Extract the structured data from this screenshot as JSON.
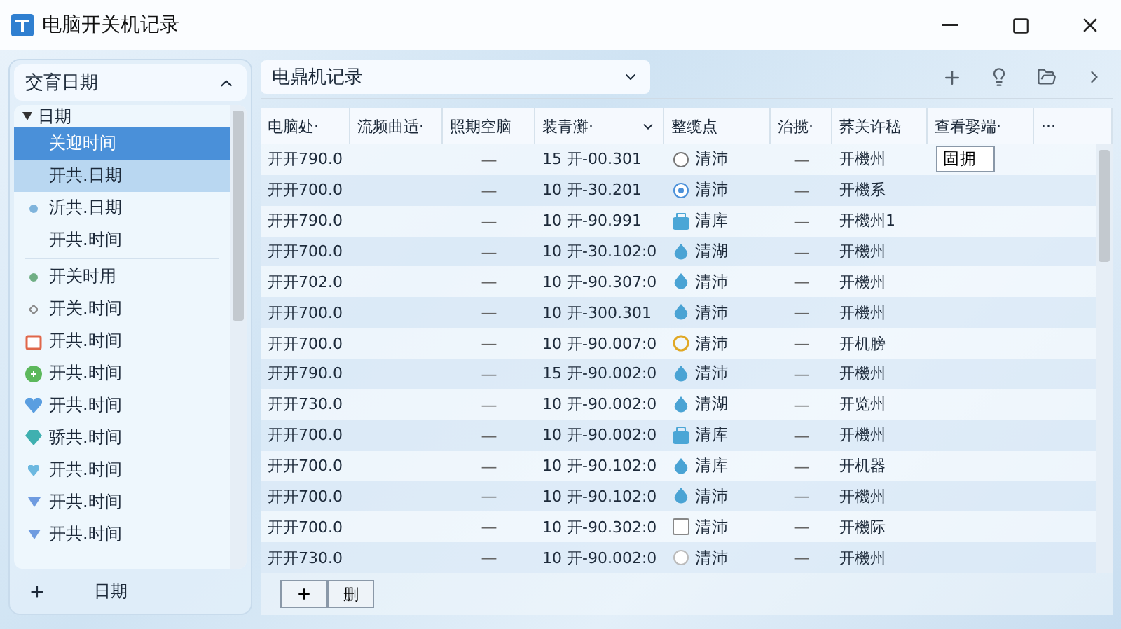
{
  "window": {
    "title": "电脑开关机记录"
  },
  "sidebar": {
    "title": "交育日期",
    "tree": {
      "label": "日期",
      "expanded": true,
      "children": [
        {
          "label": "关迎时间",
          "kind": "none",
          "selected": true,
          "highlighted": false
        },
        {
          "label": "开共.日期",
          "kind": "none",
          "selected": false,
          "highlighted": true
        },
        {
          "label": "沂共.日期",
          "kind": "dot",
          "selected": false,
          "highlighted": false
        },
        {
          "label": "开共.时间",
          "kind": "none",
          "selected": false,
          "highlighted": false
        },
        {
          "label": "开关时用",
          "kind": "green-dot",
          "selected": false,
          "highlighted": false,
          "divider_before": true
        },
        {
          "label": "开关.时间",
          "kind": "diamond",
          "selected": false,
          "highlighted": false
        },
        {
          "label": "开共.时间",
          "kind": "calendar",
          "selected": false,
          "highlighted": false
        },
        {
          "label": "开共.时间",
          "kind": "badge",
          "selected": false,
          "highlighted": false
        },
        {
          "label": "开共.时间",
          "kind": "heart",
          "selected": false,
          "highlighted": false
        },
        {
          "label": "骄共.时间",
          "kind": "gem",
          "selected": false,
          "highlighted": false
        },
        {
          "label": "开共.时间",
          "kind": "small-heart",
          "selected": false,
          "highlighted": false
        },
        {
          "label": "开共.时间",
          "kind": "triangle",
          "selected": false,
          "highlighted": false
        },
        {
          "label": "开共.时间",
          "kind": "triangle",
          "selected": false,
          "highlighted": false
        }
      ]
    },
    "footer_label": "日期"
  },
  "toolbar": {
    "view": "电鼎机记录"
  },
  "table": {
    "columns": [
      {
        "label": "电脑处·",
        "menu": false
      },
      {
        "label": "流频曲适·",
        "menu": false
      },
      {
        "label": "照期空脑",
        "menu": false
      },
      {
        "label": "装青灘·",
        "menu": true
      },
      {
        "label": "整缆点",
        "menu": false
      },
      {
        "label": "治揽·",
        "menu": false
      },
      {
        "label": "荞关许嵇",
        "menu": false
      },
      {
        "label": "查看娶端·",
        "menu": false
      },
      {
        "label": "···",
        "menu": false
      }
    ],
    "rows": [
      {
        "name": "开开790.0",
        "dash": "—",
        "time": "15 开-00.301",
        "kind": "ring",
        "status": "清沛",
        "dash2": "—",
        "note": "开機州",
        "action": "固拥"
      },
      {
        "name": "开开700.0",
        "dash": "—",
        "time": "10 开-30.201",
        "kind": "radio",
        "status": "清沛",
        "dash2": "—",
        "note": "开機系"
      },
      {
        "name": "开开790.0",
        "dash": "—",
        "time": "10 开-90.991",
        "kind": "bag",
        "status": "清库",
        "dash2": "—",
        "note": "开機州1"
      },
      {
        "name": "开开700.0",
        "dash": "—",
        "time": "10 开-30.102:0",
        "kind": "drop",
        "status": "清湖",
        "dash2": "—",
        "note": "开機州"
      },
      {
        "name": "开开702.0",
        "dash": "—",
        "time": "10 开-90.307:0",
        "kind": "drop",
        "status": "清沛",
        "dash2": "—",
        "note": "开機州"
      },
      {
        "name": "开开700.0",
        "dash": "—",
        "time": "10 开-300.301",
        "kind": "drop",
        "status": "清沛",
        "dash2": "—",
        "note": "开機州"
      },
      {
        "name": "开开700.0",
        "dash": "—",
        "time": "10 开-90.007:0",
        "kind": "yellow-ring",
        "status": "清沛",
        "dash2": "—",
        "note": "开机膀"
      },
      {
        "name": "开开790.0",
        "dash": "—",
        "time": "15 开-90.002:0",
        "kind": "drop",
        "status": "清沛",
        "dash2": "—",
        "note": "开機州"
      },
      {
        "name": "开开730.0",
        "dash": "—",
        "time": "10 开-90.002:0",
        "kind": "drop",
        "status": "清湖",
        "dash2": "—",
        "note": "开览州"
      },
      {
        "name": "开开700.0",
        "dash": "—",
        "time": "10 开-90.002:0",
        "kind": "bag",
        "status": "清库",
        "dash2": "—",
        "note": "开機州"
      },
      {
        "name": "开开700.0",
        "dash": "—",
        "time": "10 开-90.102:0",
        "kind": "drop",
        "status": "清库",
        "dash2": "—",
        "note": "开机器"
      },
      {
        "name": "开开700.0",
        "dash": "—",
        "time": "10 开-90.102:0",
        "kind": "drop",
        "status": "清沛",
        "dash2": "—",
        "note": "开機州"
      },
      {
        "name": "开开700.0",
        "dash": "—",
        "time": "10 开-90.302:0",
        "kind": "checkbox",
        "status": "清沛",
        "dash2": "—",
        "note": "开機际"
      },
      {
        "name": "开开730.0",
        "dash": "—",
        "time": "10 开-90.002:0",
        "kind": "faint-ring",
        "status": "清沛",
        "dash2": "—",
        "note": "开機州"
      }
    ]
  },
  "footer": {
    "delete_label": "删"
  }
}
